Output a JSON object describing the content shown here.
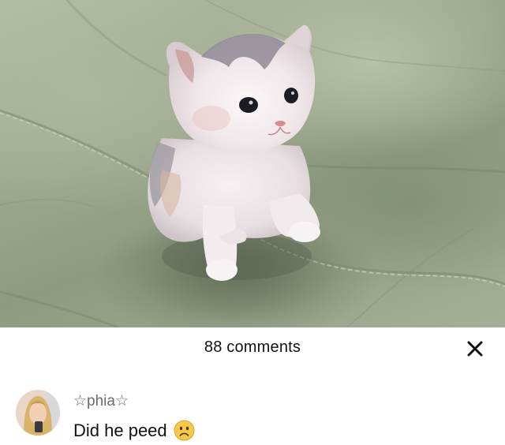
{
  "comments_panel": {
    "count_label": "88 comments",
    "close_icon": "close-icon"
  },
  "comment": {
    "username": "☆phia☆",
    "text": "Did he peed",
    "emoji": "frowning-face-emoji",
    "avatar_icon": "user-avatar"
  },
  "colors": {
    "sheet_background": "#ffffff",
    "text_primary": "#111111",
    "username_text": "#6b6b6b"
  }
}
